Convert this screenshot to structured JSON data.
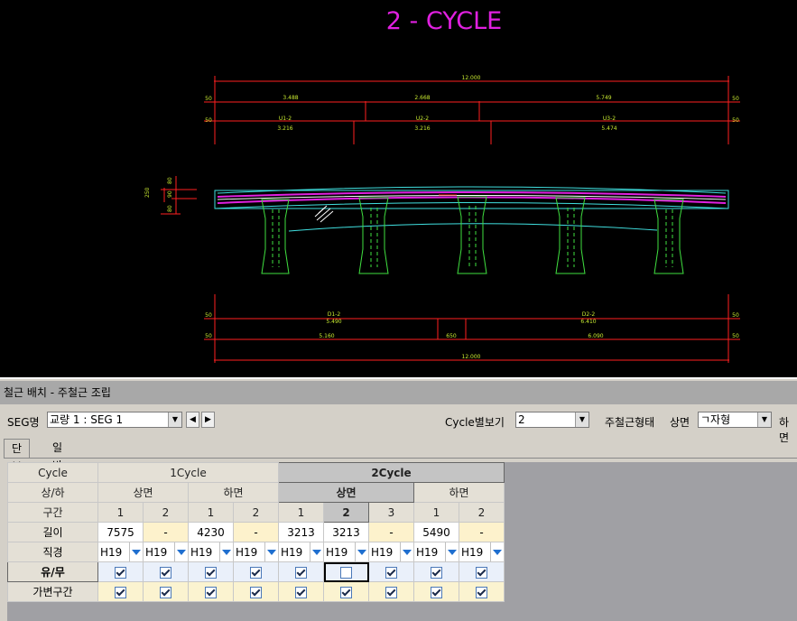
{
  "drawing": {
    "title": "2 - CYCLE",
    "top_total": "12.000",
    "top_row1": [
      "50",
      "3.488",
      "2.668",
      "5.749",
      "50"
    ],
    "top_row2": [
      "50",
      "50"
    ],
    "top_u_labels": [
      {
        "name": "U1-2",
        "len": "3.216"
      },
      {
        "name": "U2-2",
        "len": "3.216"
      },
      {
        "name": "U3-2",
        "len": "5.474"
      }
    ],
    "section_dims": [
      "250",
      "80",
      "90",
      "80"
    ],
    "bot_d_labels": [
      {
        "name": "D1-2",
        "len": "5.490"
      },
      {
        "name": "D2-2",
        "len": "6.410"
      }
    ],
    "bot_row1": [
      "50",
      "50"
    ],
    "bot_row2": [
      "50",
      "5.160",
      "650",
      "6.090",
      "50"
    ],
    "bot_total": "12.000",
    "side_ends": [
      "50",
      "50"
    ]
  },
  "panel": {
    "title": "철근 배치 - 주철근 조립",
    "seg_label": "SEG명",
    "seg_value": "교량 1 : SEG 1",
    "prev_btn": "◀",
    "next_btn": "▶",
    "cycle_label": "Cycle별보기",
    "cycle_value": "2",
    "type_label": "주철근형태",
    "top_label": "상면",
    "top_value": "ㄱ자형",
    "bottom_label": "하면",
    "tabs": [
      "단부",
      "일반부"
    ]
  },
  "grid": {
    "row_headers": [
      "Cycle",
      "상/하",
      "구간",
      "길이",
      "직경",
      "유/무",
      "가변구간"
    ],
    "cycles": [
      "1Cycle",
      "2Cycle"
    ],
    "faces": [
      "상면",
      "하면",
      "상면",
      "하면"
    ],
    "sections": [
      "1",
      "2",
      "1",
      "2",
      "1",
      "2",
      "3",
      "1",
      "2"
    ],
    "lengths": [
      "7575",
      "-",
      "4230",
      "-",
      "3213",
      "3213",
      "-",
      "5490",
      "-"
    ],
    "diameters": [
      "H19",
      "H19",
      "H19",
      "H19",
      "H19",
      "H19",
      "H19",
      "H19",
      "H19"
    ],
    "exists": [
      true,
      true,
      true,
      true,
      true,
      false,
      true,
      true,
      true
    ],
    "variable": [
      true,
      true,
      true,
      true,
      true,
      true,
      true,
      true,
      true
    ]
  }
}
